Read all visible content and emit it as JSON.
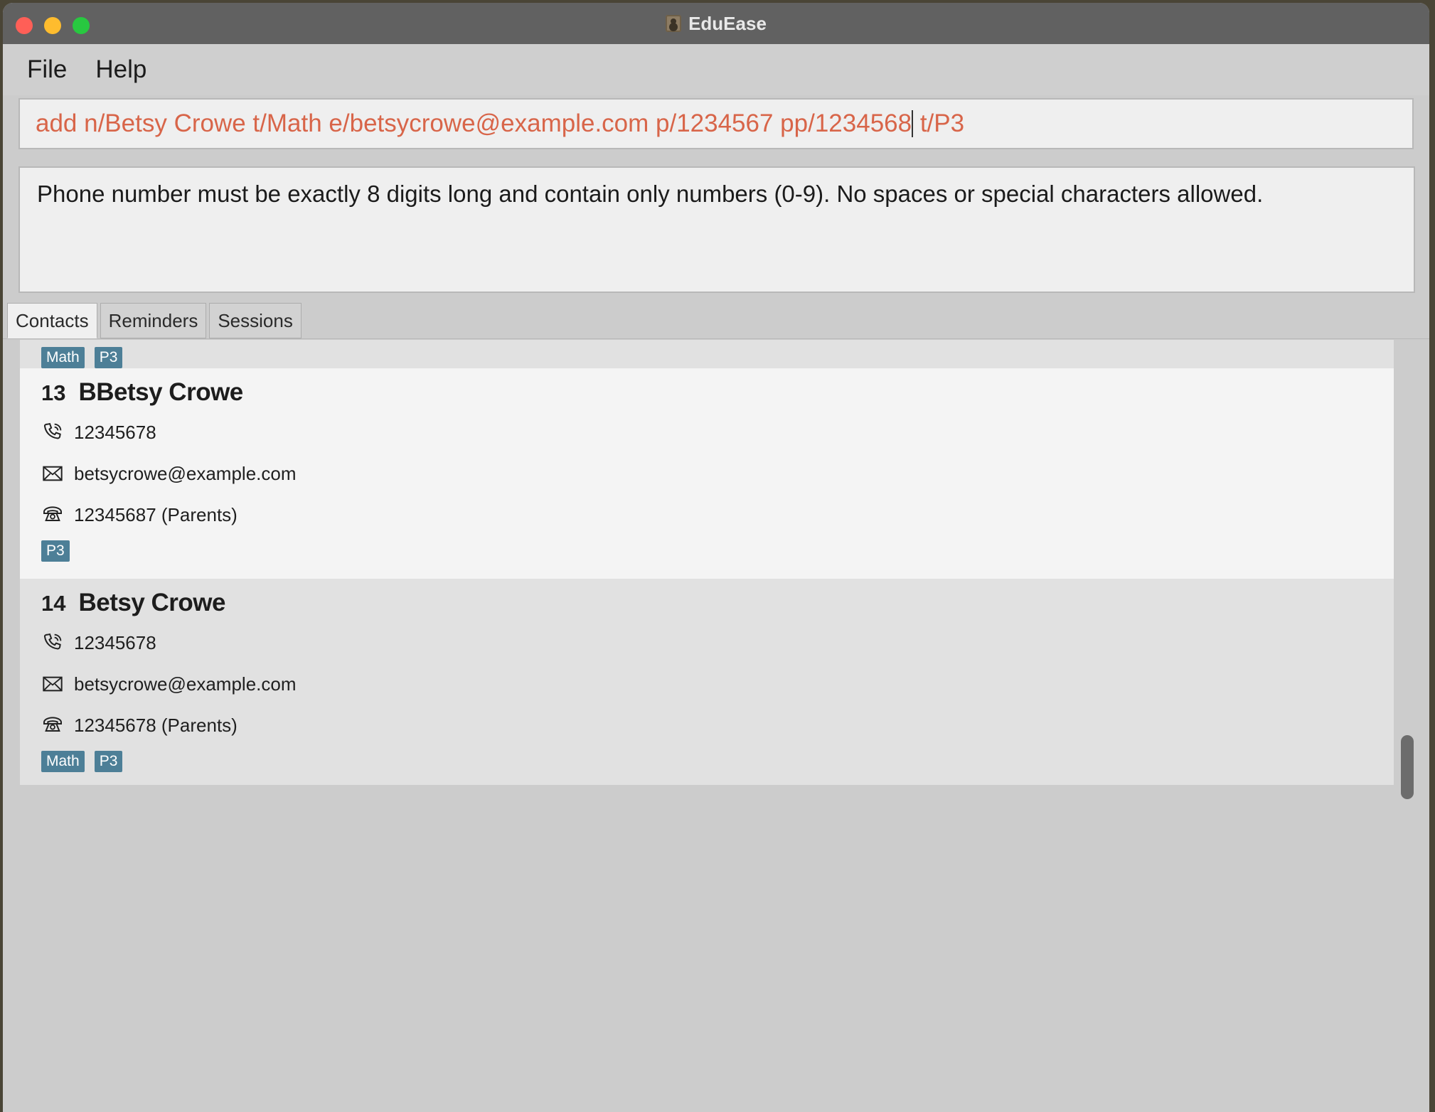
{
  "window": {
    "title": "EduEase"
  },
  "menu": [
    "File",
    "Help"
  ],
  "command": {
    "before_cursor": "add n/Betsy Crowe t/Math e/betsycrowe@example.com p/1234567 pp/1234568",
    "after_cursor": " t/P3"
  },
  "result": "Phone number must be exactly 8 digits long and contain only numbers (0-9). No spaces or special characters allowed.",
  "tabs": [
    "Contacts",
    "Reminders",
    "Sessions"
  ],
  "contacts": {
    "partial": {
      "tags": [
        "Math",
        "P3"
      ]
    },
    "items": [
      {
        "index": "13",
        "name": "BBetsy Crowe",
        "phone": "12345678",
        "email": "betsycrowe@example.com",
        "parent_phone": "12345687 (Parents)",
        "tags": [
          "P3"
        ]
      },
      {
        "index": "14",
        "name": "Betsy Crowe",
        "phone": "12345678",
        "email": "betsycrowe@example.com",
        "parent_phone": "12345678 (Parents)",
        "tags": [
          "Math",
          "P3"
        ]
      }
    ]
  }
}
